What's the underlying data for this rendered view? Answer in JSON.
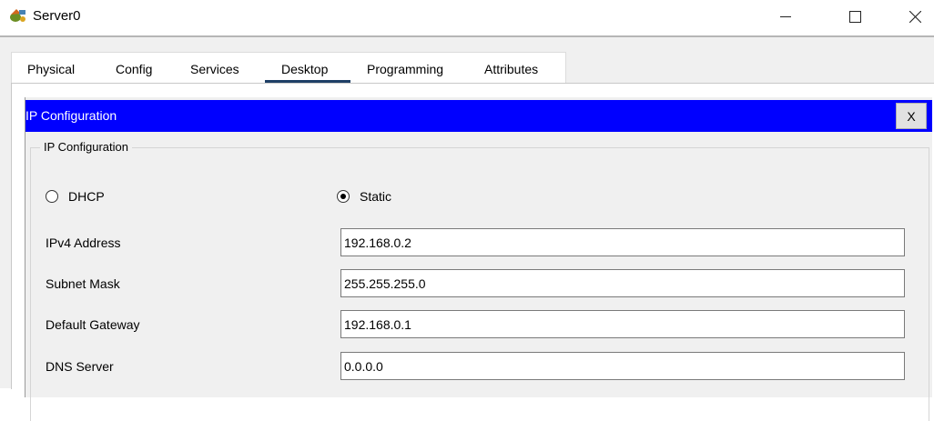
{
  "window": {
    "title": "Server0",
    "icon": "server-app-icon",
    "controls": [
      "minimize-icon",
      "maximize-icon",
      "close-icon"
    ]
  },
  "tabs": [
    {
      "label": "Physical"
    },
    {
      "label": "Config"
    },
    {
      "label": "Services"
    },
    {
      "label": "Desktop",
      "active": true
    },
    {
      "label": "Programming"
    },
    {
      "label": "Attributes"
    }
  ],
  "panel": {
    "title": "IP Configuration",
    "close_label": "X",
    "header_color": "#0000ff",
    "group_title": "IP Configuration",
    "mode": {
      "dhcp_label": "DHCP",
      "static_label": "Static",
      "selected": "Static"
    },
    "fields": [
      {
        "label": "IPv4 Address",
        "value": "192.168.0.2"
      },
      {
        "label": "Subnet Mask",
        "value": "255.255.255.0"
      },
      {
        "label": "Default Gateway",
        "value": "192.168.0.1"
      },
      {
        "label": "DNS Server",
        "value": "0.0.0.0"
      }
    ]
  }
}
